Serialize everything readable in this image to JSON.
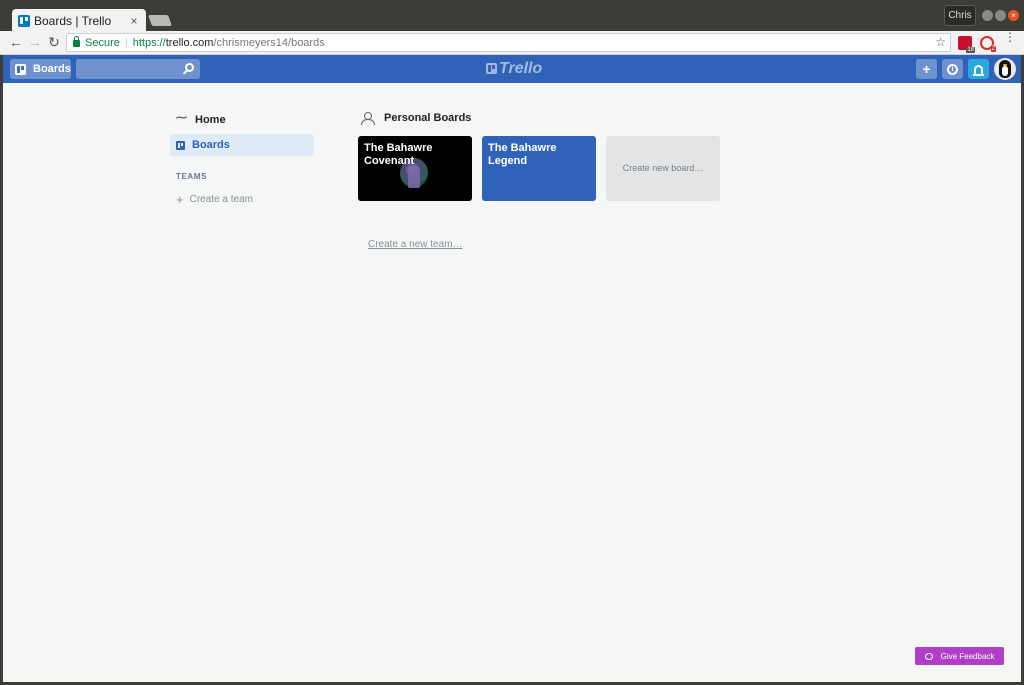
{
  "browser": {
    "tab_title": "Boards | Trello",
    "tab_close": "×",
    "profile_name": "Chris",
    "secure_label": "Secure",
    "url_scheme": "https://",
    "url_host": "trello.com",
    "url_path": "/chrismeyers14/boards",
    "star_glyph": "☆",
    "menu_glyph": "⋮",
    "ext1_badge": "18",
    "ext2_badge": "2"
  },
  "header": {
    "boards_label": "Boards",
    "logo_text": "Trello",
    "add_glyph": "+",
    "info_glyph": "i"
  },
  "sidebar": {
    "home_label": "Home",
    "boards_label": "Boards",
    "teams_heading": "TEAMS",
    "create_team_label": "Create a team"
  },
  "main": {
    "section_title": "Personal Boards",
    "boards": [
      {
        "name": "The Bahawre\nCovenant",
        "background": "#000000"
      },
      {
        "name": "The Bahawre\nLegend",
        "background": "#3063b8"
      }
    ],
    "create_board_label": "Create new board…",
    "create_team_link": "Create a new team…"
  },
  "feedback": {
    "label": "Give Feedback"
  },
  "colors": {
    "header": "#3063b8",
    "notifications": "#29a8e0",
    "feedback": "#b03fc6",
    "sidebar_active": "#e1ebf7"
  },
  "icons": [
    "search-icon",
    "info-icon",
    "bell-icon",
    "person-icon",
    "home-icon",
    "plus-icon",
    "lock-icon",
    "star-icon",
    "feedback-icon"
  ]
}
